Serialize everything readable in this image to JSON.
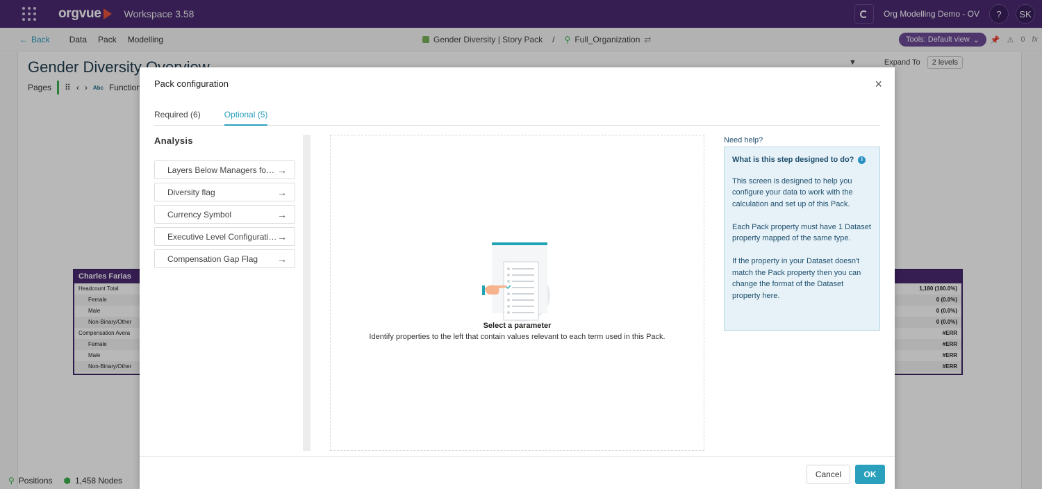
{
  "app": {
    "logo": "orgvue",
    "workspace": "Workspace 3.58",
    "org_title": "Org Modelling Demo - OV",
    "help_label": "?",
    "user_initials": "SK"
  },
  "nav": {
    "back_label": "Back",
    "links": [
      "Data",
      "Pack",
      "Modelling"
    ],
    "breadcrumb_pack": "Gender Diversity | Story Pack",
    "breadcrumb_sep": "/",
    "breadcrumb_dataset": "Full_Organization",
    "tools_label": "Tools: Default view",
    "alert_count": "0",
    "fx_label": "fx"
  },
  "page": {
    "title": "Gender Diversity Overview",
    "pages_label": "Pages",
    "page_tab_abbr": "Abc",
    "page_tab_label": "Functional",
    "expand_label": "Expand To",
    "levels_value": "2 levels"
  },
  "node_left": {
    "name": "Charles Farias",
    "rows": [
      "Headcount Total",
      "Female",
      "Male",
      "Non-Binary/Other",
      "Compensation Avera",
      "Female",
      "Male",
      "Non-Binary/Other"
    ]
  },
  "node_right": {
    "rows": [
      "1,180 (100.0%)",
      "0 (0.0%)",
      "0 (0.0%)",
      "0 (0.0%)",
      "#ERR",
      "#ERR",
      "#ERR",
      "#ERR"
    ]
  },
  "status": {
    "positions_label": "Positions",
    "nodes_label": "1,458 Nodes"
  },
  "modal": {
    "title": "Pack configuration",
    "close_icon": "×",
    "tabs": [
      {
        "label": "Required (6)",
        "active": false
      },
      {
        "label": "Optional (5)",
        "active": true
      }
    ],
    "analysis_title": "Analysis",
    "parameters": [
      "Layers Below Managers for Analysis",
      "Diversity flag",
      "Currency Symbol",
      "Executive Level Configuration",
      "Compensation Gap Flag"
    ],
    "arrow_icon": "→",
    "empty_title": "Select a parameter",
    "empty_desc": "Identify properties to the left that contain values relevant to each term used in this Pack.",
    "help_label": "Need help?",
    "help_question": "What is this step designed to do?",
    "help_paragraphs": [
      "This screen is designed to help you configure your data to work with the calculation and set up of this Pack.",
      "Each Pack property must have 1 Dataset property mapped of the same type.",
      "If the property in your Dataset doesn't match the Pack property then you can change the format of the Dataset property here."
    ],
    "cancel_label": "Cancel",
    "ok_label": "OK"
  },
  "colors": {
    "brand_purple": "#4b2a73",
    "accent_teal": "#2aa0bd",
    "help_bg": "#e6f2f7"
  }
}
